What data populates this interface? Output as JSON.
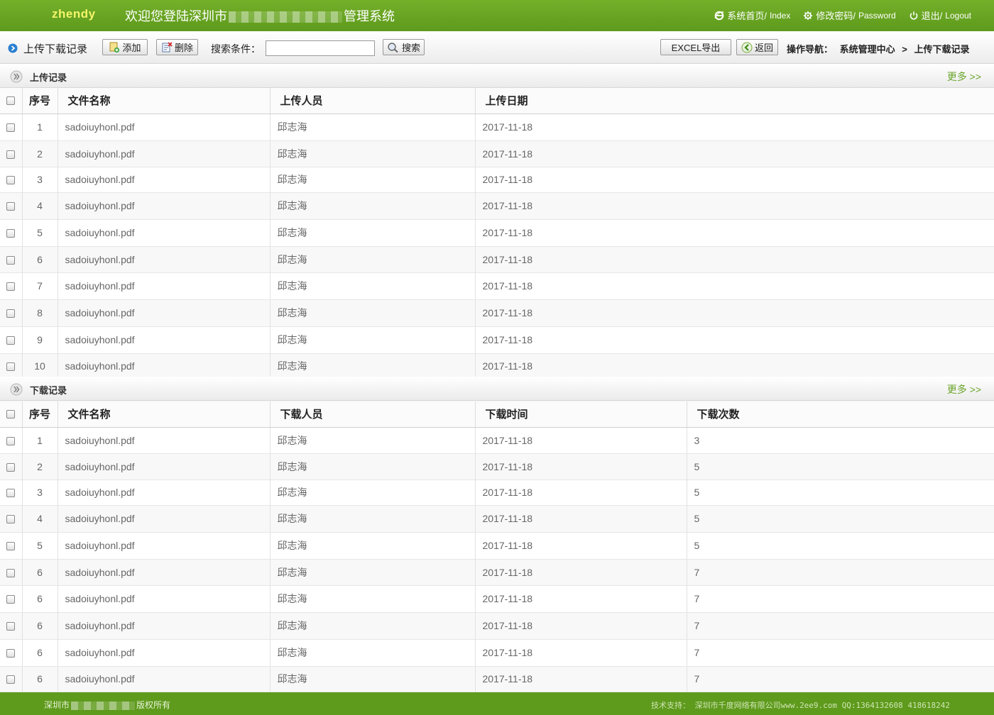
{
  "header": {
    "brand": "zhendy",
    "welcome_prefix": "欢迎您登陆深圳市",
    "welcome_suffix": "管理系统",
    "links": [
      {
        "icon": "ie-icon",
        "zh": "系统首页/",
        "en": "Index"
      },
      {
        "icon": "gear-icon",
        "zh": "修改密码/",
        "en": "Password"
      },
      {
        "icon": "power-icon",
        "zh": "退出/",
        "en": "Logout"
      }
    ]
  },
  "toolbar": {
    "title": "上传下载记录",
    "add_label": "添加",
    "delete_label": "删除",
    "search_label": "搜索条件：",
    "search_value": "",
    "search_button": "搜索",
    "excel_label": "EXCEL导出",
    "back_label": "返回",
    "nav_label": "操作导航：",
    "breadcrumb": [
      "系统管理中心",
      "上传下载记录"
    ],
    "breadcrumb_sep": ">"
  },
  "upload": {
    "title": "上传记录",
    "more": "更多 >>",
    "headers": [
      "序号",
      "文件名称",
      "上传人员",
      "上传日期"
    ],
    "rows": [
      [
        "1",
        "sadoiuyhonl.pdf",
        "邱志海",
        "2017-11-18"
      ],
      [
        "2",
        "sadoiuyhonl.pdf",
        "邱志海",
        "2017-11-18"
      ],
      [
        "3",
        "sadoiuyhonl.pdf",
        "邱志海",
        "2017-11-18"
      ],
      [
        "4",
        "sadoiuyhonl.pdf",
        "邱志海",
        "2017-11-18"
      ],
      [
        "5",
        "sadoiuyhonl.pdf",
        "邱志海",
        "2017-11-18"
      ],
      [
        "6",
        "sadoiuyhonl.pdf",
        "邱志海",
        "2017-11-18"
      ],
      [
        "7",
        "sadoiuyhonl.pdf",
        "邱志海",
        "2017-11-18"
      ],
      [
        "8",
        "sadoiuyhonl.pdf",
        "邱志海",
        "2017-11-18"
      ],
      [
        "9",
        "sadoiuyhonl.pdf",
        "邱志海",
        "2017-11-18"
      ],
      [
        "10",
        "sadoiuyhonl.pdf",
        "邱志海",
        "2017-11-18"
      ]
    ]
  },
  "download": {
    "title": "下载记录",
    "more": "更多 >>",
    "headers": [
      "序号",
      "文件名称",
      "下载人员",
      "下载时间",
      "下载次数"
    ],
    "rows": [
      [
        "1",
        "sadoiuyhonl.pdf",
        "邱志海",
        "2017-11-18",
        "3"
      ],
      [
        "2",
        "sadoiuyhonl.pdf",
        "邱志海",
        "2017-11-18",
        "5"
      ],
      [
        "3",
        "sadoiuyhonl.pdf",
        "邱志海",
        "2017-11-18",
        "5"
      ],
      [
        "4",
        "sadoiuyhonl.pdf",
        "邱志海",
        "2017-11-18",
        "5"
      ],
      [
        "5",
        "sadoiuyhonl.pdf",
        "邱志海",
        "2017-11-18",
        "5"
      ],
      [
        "6",
        "sadoiuyhonl.pdf",
        "邱志海",
        "2017-11-18",
        "7"
      ],
      [
        "6",
        "sadoiuyhonl.pdf",
        "邱志海",
        "2017-11-18",
        "7"
      ],
      [
        "6",
        "sadoiuyhonl.pdf",
        "邱志海",
        "2017-11-18",
        "7"
      ],
      [
        "6",
        "sadoiuyhonl.pdf",
        "邱志海",
        "2017-11-18",
        "7"
      ],
      [
        "6",
        "sadoiuyhonl.pdf",
        "邱志海",
        "2017-11-18",
        "7"
      ]
    ]
  },
  "footer": {
    "left_prefix": "深圳市",
    "left_suffix": "版权所有",
    "right": "技术支持： 深圳市千度网络有限公司www.2ee9.com   QQ:1364132608 418618242"
  },
  "colors": {
    "header": "#6aa624",
    "accent": "#6aa52b",
    "brand": "#f5f56a"
  }
}
